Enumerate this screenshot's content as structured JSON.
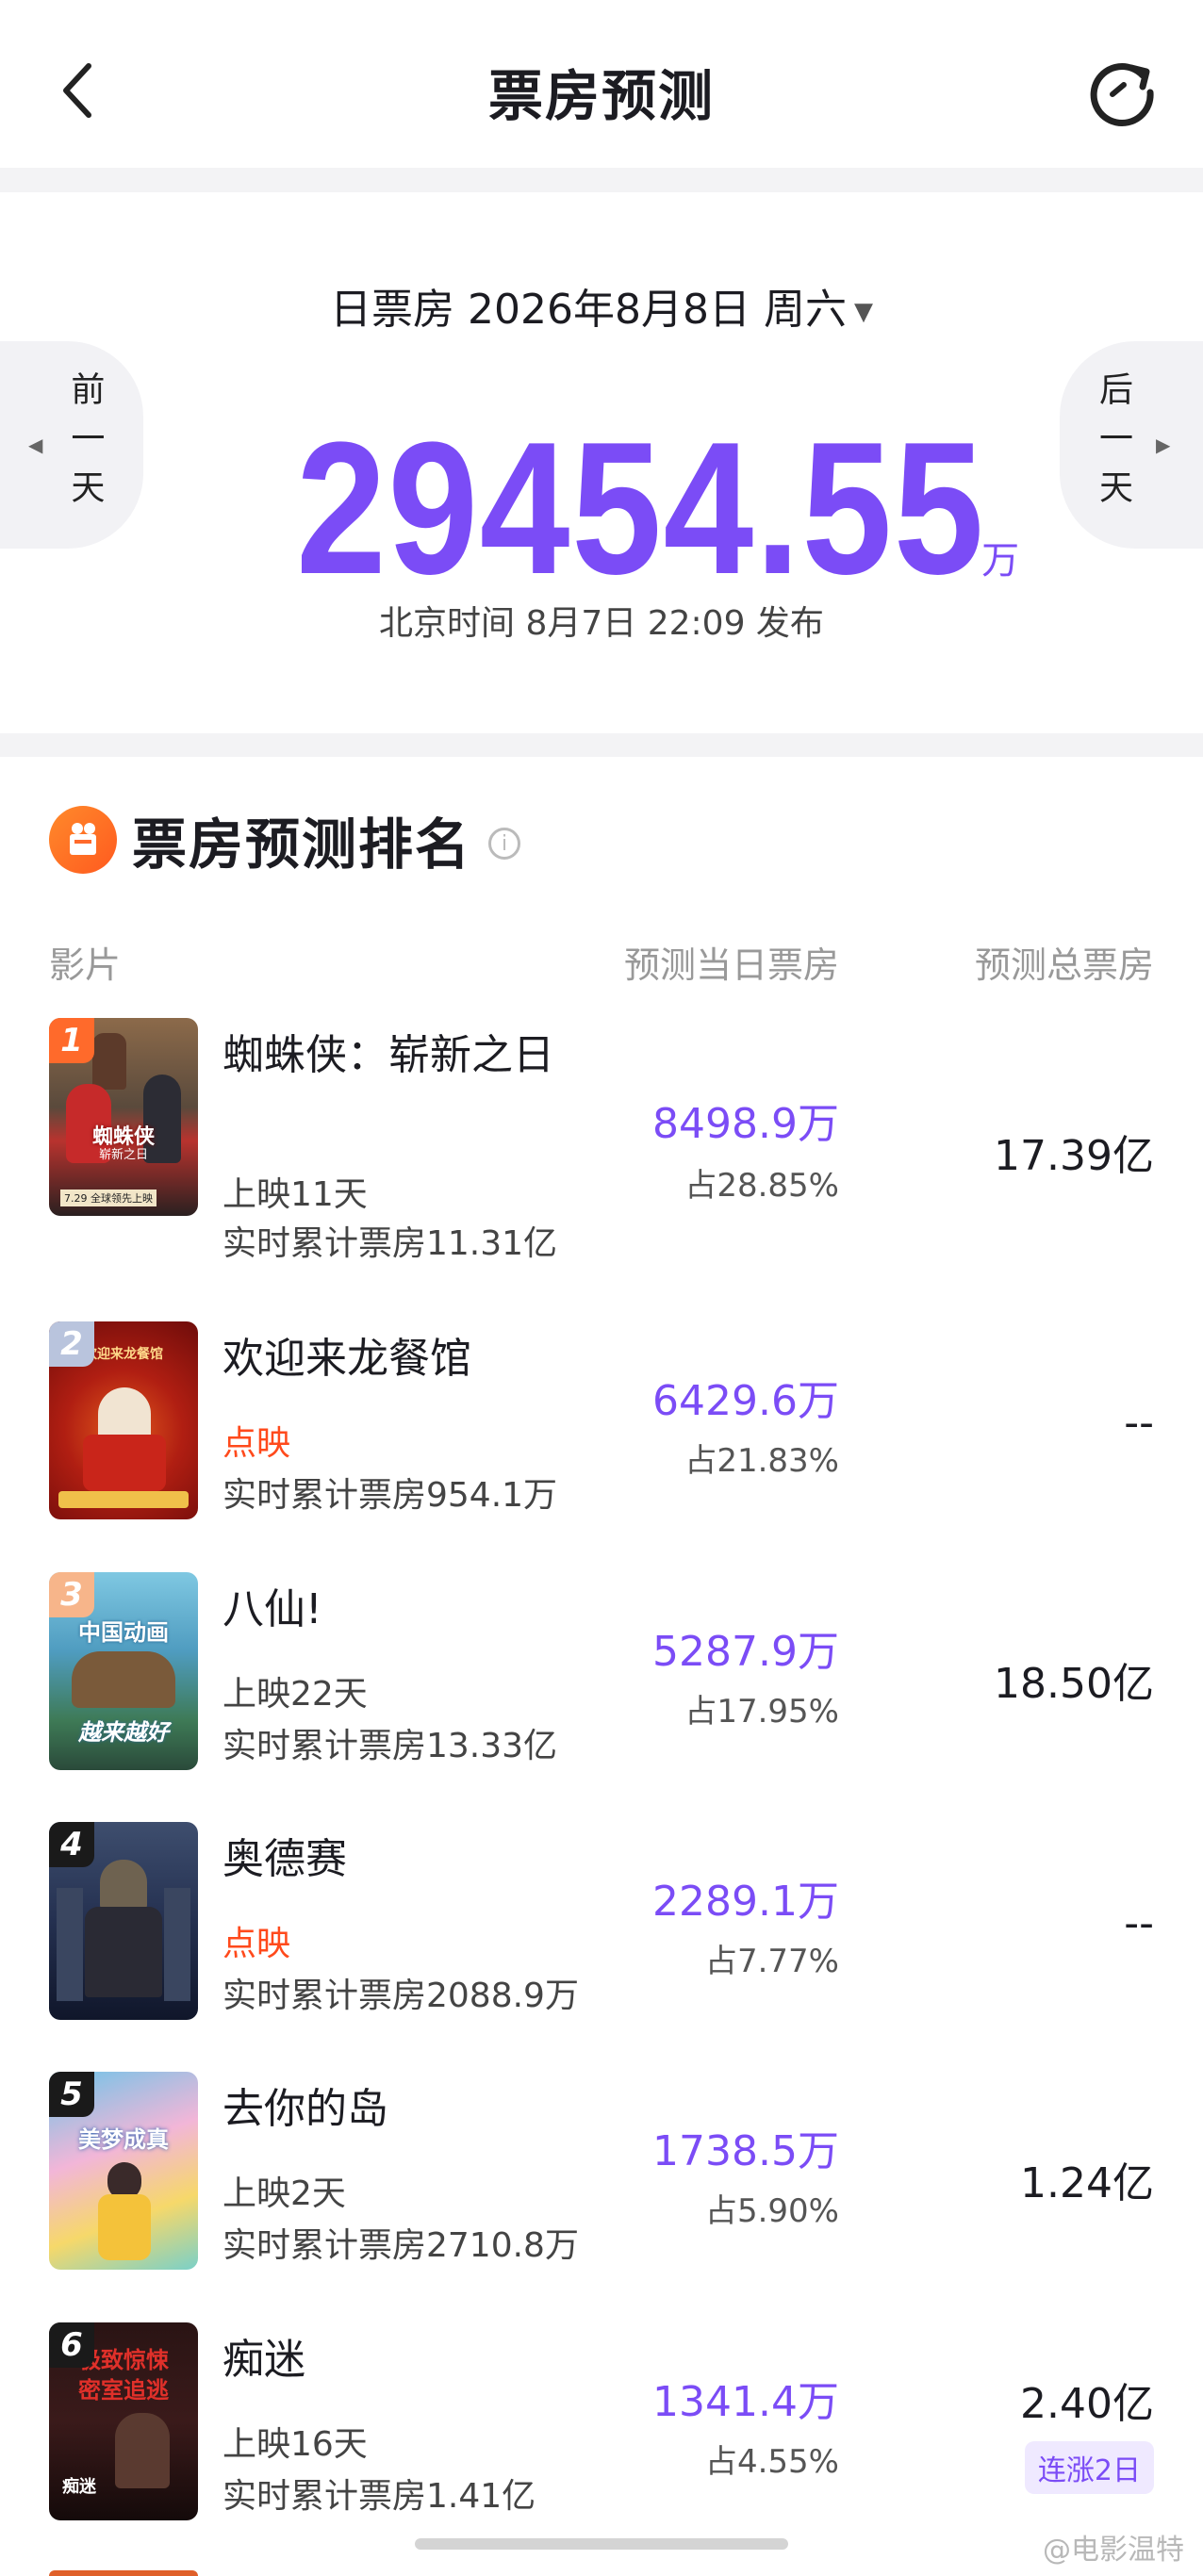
{
  "header": {
    "title": "票房预测"
  },
  "hero": {
    "date_label": "日票房 2026年8月8日 周六",
    "caret": "▼",
    "prev_label": "前一天",
    "prev_arrow": "◀",
    "next_label": "后一天",
    "next_arrow": "▶",
    "amount": "29454.55",
    "unit": "万",
    "published": "北京时间 8月7日 22:09 发布"
  },
  "ranking": {
    "title": "票房预测排名",
    "info_glyph": "i",
    "columns": {
      "film": "影片",
      "day": "预测当日票房",
      "total": "预测总票房"
    },
    "movies": [
      {
        "rank": "1",
        "name": "蜘蛛侠：崭新之日",
        "meta1": "上映11天",
        "meta1_type": "normal",
        "meta2": "实时累计票房11.31亿",
        "day": "8498.9万",
        "share": "占28.85%",
        "total": "17.39亿",
        "tag": ""
      },
      {
        "rank": "2",
        "name": "欢迎来龙餐馆",
        "meta1": "点映",
        "meta1_type": "preview",
        "meta2": "实时累计票房954.1万",
        "day": "6429.6万",
        "share": "占21.83%",
        "total": "--",
        "tag": ""
      },
      {
        "rank": "3",
        "name": "八仙!",
        "meta1": "上映22天",
        "meta1_type": "normal",
        "meta2": "实时累计票房13.33亿",
        "day": "5287.9万",
        "share": "占17.95%",
        "total": "18.50亿",
        "tag": ""
      },
      {
        "rank": "4",
        "name": "奥德赛",
        "meta1": "点映",
        "meta1_type": "preview",
        "meta2": "实时累计票房2088.9万",
        "day": "2289.1万",
        "share": "占7.77%",
        "total": "--",
        "tag": ""
      },
      {
        "rank": "5",
        "name": "去你的岛",
        "meta1": "上映2天",
        "meta1_type": "normal",
        "meta2": "实时累计票房2710.8万",
        "day": "1738.5万",
        "share": "占5.90%",
        "total": "1.24亿",
        "tag": ""
      },
      {
        "rank": "6",
        "name": "痴迷",
        "meta1": "上映16天",
        "meta1_type": "normal",
        "meta2": "实时累计票房1.41亿",
        "day": "1341.4万",
        "share": "占4.55%",
        "total": "2.40亿",
        "tag": "连涨2日"
      }
    ],
    "poster_texts": {
      "p1_line1": "蜘蛛侠",
      "p1_line2": "崭新之日",
      "p1_date": "7.29 全球领先上映",
      "p2_line1": "欢迎来龙餐馆",
      "p3_line1": "中国动画",
      "p3_line2": "越来越好",
      "p5_line1": "美梦成真",
      "p6_line1": "极致惊悚",
      "p6_line2": "密室追逃",
      "p6_line3": "痴迷"
    }
  },
  "watermark": "@电影温特",
  "colors": {
    "accent": "#7b4cf6",
    "preview_red": "#ff4a1c",
    "rank1": "#ff6a2b",
    "rank2": "#b9c4dd",
    "rank3": "#f7b58a",
    "rank_other": "#1a1a1a"
  }
}
